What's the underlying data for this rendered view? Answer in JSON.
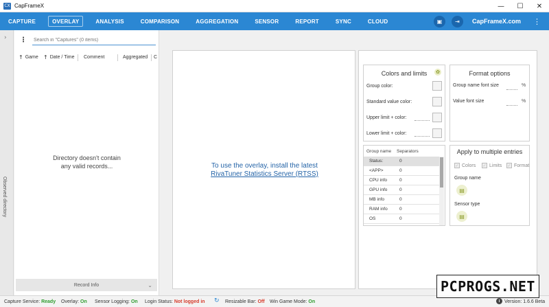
{
  "window": {
    "title": "CapFrameX",
    "icon_label": "CX"
  },
  "menu": {
    "items": [
      "CAPTURE",
      "OVERLAY",
      "ANALYSIS",
      "COMPARISON",
      "AGGREGATION",
      "SENSOR",
      "REPORT",
      "SYNC",
      "CLOUD"
    ],
    "active": "OVERLAY",
    "brand": "CapFrameX.com"
  },
  "sidebar": {
    "label": "Observed directory"
  },
  "captures": {
    "search_placeholder": "Search in \"Captures\" (0 items)",
    "columns": [
      "Game",
      "Date / Time",
      "Comment",
      "Aggregated",
      "C"
    ],
    "empty_line1": "Directory doesn't contain",
    "empty_line2": "any valid records...",
    "record_info": "Record Info"
  },
  "overlay": {
    "msg_line1": "To use the overlay, install the latest",
    "msg_line2": "RivaTuner Statistics Server (RTSS)"
  },
  "colors_limits": {
    "title": "Colors and limits",
    "rows": [
      "Group color:",
      "Standard value color:",
      "Upper limit + color:",
      "Lower limit + color:"
    ]
  },
  "format_options": {
    "title": "Format options",
    "group_font": "Group name font size",
    "value_font": "Value font size",
    "unit": "%"
  },
  "entries": {
    "headers": [
      "Group name",
      "Separators"
    ],
    "rows": [
      {
        "name": "Status:",
        "sep": "0"
      },
      {
        "name": "<APP>",
        "sep": "0"
      },
      {
        "name": "CPU info",
        "sep": "0"
      },
      {
        "name": "GPU info",
        "sep": "0"
      },
      {
        "name": "MB info",
        "sep": "0"
      },
      {
        "name": "RAM info",
        "sep": "0"
      },
      {
        "name": "OS",
        "sep": "0"
      }
    ]
  },
  "apply_multi": {
    "title": "Apply to multiple entries",
    "checks": [
      "Colors",
      "Limits",
      "Format"
    ],
    "group_name": "Group name",
    "sensor_type": "Sensor type"
  },
  "status": {
    "capture_service_label": "Capture Service:",
    "capture_service_value": "Ready",
    "overlay_label": "Overlay:",
    "overlay_value": "On",
    "sensor_logging_label": "Sensor Logging:",
    "sensor_logging_value": "On",
    "login_label": "Login Status:",
    "login_value": "Not logged in",
    "resizable_bar_label": "Resizable Bar:",
    "resizable_bar_value": "Off",
    "win_game_mode_label": "Win Game Mode:",
    "win_game_mode_value": "On",
    "version": "Version: 1.6.6 Beta"
  },
  "watermark": "PCPROGS.NET"
}
